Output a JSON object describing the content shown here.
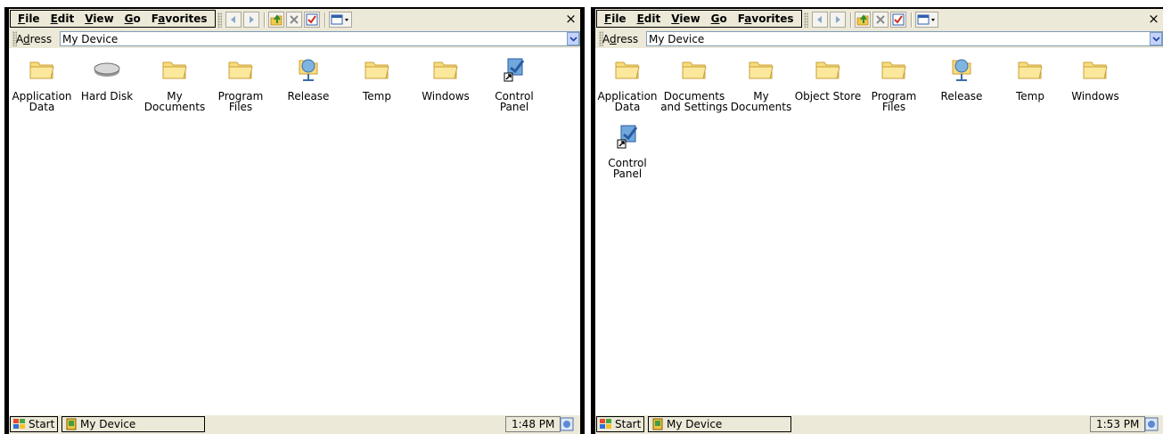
{
  "windows": [
    {
      "menu": [
        {
          "accel": "F",
          "rest": "ile"
        },
        {
          "accel": "E",
          "rest": "dit"
        },
        {
          "accel": "V",
          "rest": "iew"
        },
        {
          "accel": "G",
          "rest": "o"
        },
        {
          "pre": "F",
          "accel": "a",
          "rest": "vorites"
        }
      ],
      "address": {
        "label_accel": "d",
        "label_pre": "A",
        "label_rest": "ress",
        "value": "My Device"
      },
      "icons": [
        {
          "type": "folder",
          "label": "Application Data"
        },
        {
          "type": "harddisk",
          "label": "Hard Disk"
        },
        {
          "type": "folder",
          "label": "My Documents"
        },
        {
          "type": "folder",
          "label": "Program Files"
        },
        {
          "type": "network-folder",
          "label": "Release"
        },
        {
          "type": "folder",
          "label": "Temp"
        },
        {
          "type": "folder",
          "label": "Windows"
        },
        {
          "type": "shortcut",
          "label": "Control Panel"
        }
      ],
      "taskbar": {
        "start": "Start",
        "task": "My Device",
        "clock": "1:48 PM"
      }
    },
    {
      "menu": [
        {
          "accel": "F",
          "rest": "ile"
        },
        {
          "accel": "E",
          "rest": "dit"
        },
        {
          "accel": "V",
          "rest": "iew"
        },
        {
          "accel": "G",
          "rest": "o"
        },
        {
          "pre": "F",
          "accel": "a",
          "rest": "vorites"
        }
      ],
      "address": {
        "label_accel": "d",
        "label_pre": "A",
        "label_rest": "ress",
        "value": "My Device"
      },
      "icons": [
        {
          "type": "folder",
          "label": "Application Data"
        },
        {
          "type": "folder",
          "label": "Documents and Settings"
        },
        {
          "type": "folder",
          "label": "My Documents"
        },
        {
          "type": "folder",
          "label": "Object Store"
        },
        {
          "type": "folder",
          "label": "Program Files"
        },
        {
          "type": "network-folder",
          "label": "Release"
        },
        {
          "type": "folder",
          "label": "Temp"
        },
        {
          "type": "folder",
          "label": "Windows"
        },
        {
          "type": "shortcut",
          "label": "Control Panel"
        }
      ],
      "taskbar": {
        "start": "Start",
        "task": "My Device",
        "clock": "1:53 PM"
      }
    }
  ],
  "close_glyph": "×"
}
